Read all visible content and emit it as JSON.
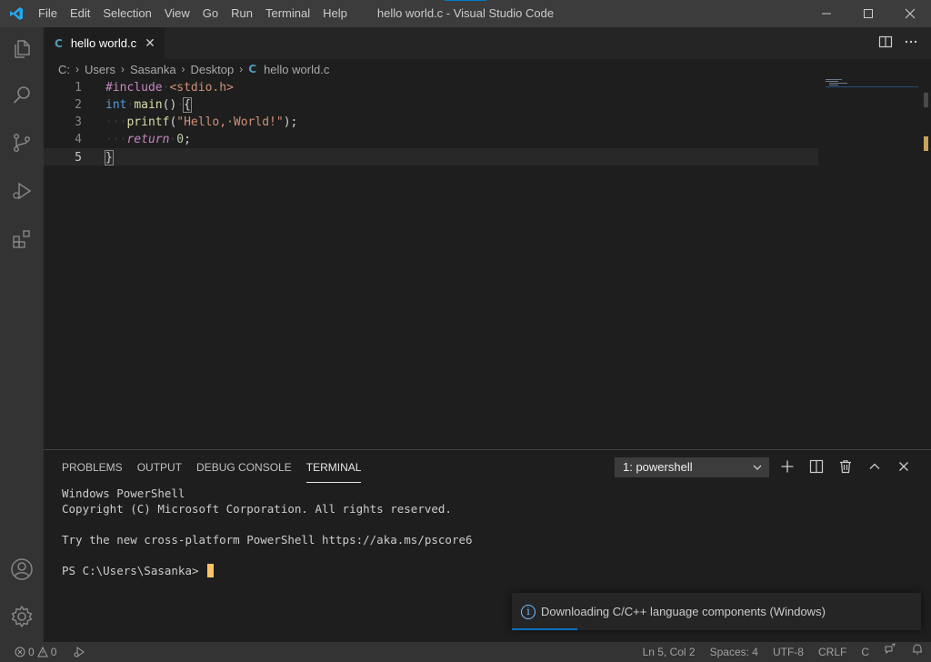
{
  "window": {
    "title": "hello world.c - Visual Studio Code",
    "menu": [
      "File",
      "Edit",
      "Selection",
      "View",
      "Go",
      "Run",
      "Terminal",
      "Help"
    ]
  },
  "activity_bar": {
    "items": [
      "explorer-icon",
      "search-icon",
      "source-control-icon",
      "run-debug-icon",
      "extensions-icon"
    ],
    "bottom": [
      "account-icon",
      "manage-gear-icon"
    ]
  },
  "tab": {
    "icon_text": "C",
    "label": "hello world.c",
    "close": "✕"
  },
  "breadcrumb": {
    "parts": [
      "C:",
      "Users",
      "Sasanka",
      "Desktop"
    ],
    "file_icon": "C",
    "file": "hello world.c"
  },
  "editor": {
    "line_numbers": [
      "1",
      "2",
      "3",
      "4",
      "5"
    ],
    "lines": [
      {
        "pre": "#include",
        "sp": "·",
        "inc": "<stdio.h>"
      },
      {
        "type": "int",
        "sp1": "·",
        "fn": "main",
        "rest": "()",
        "sp2": "·",
        "brace": "{"
      },
      {
        "ws": "···",
        "fn": "printf",
        "open": "(",
        "str": "\"Hello,·World!\"",
        "close": ");"
      },
      {
        "ws": "···",
        "kw": "return",
        "sp": "·",
        "num": "0",
        "semi": ";"
      },
      {
        "brace": "}"
      }
    ]
  },
  "panel": {
    "tabs": [
      "PROBLEMS",
      "OUTPUT",
      "DEBUG CONSOLE",
      "TERMINAL"
    ],
    "active_tab": "TERMINAL",
    "terminal_select": "1: powershell",
    "terminal_lines": [
      "Windows PowerShell",
      "Copyright (C) Microsoft Corporation. All rights reserved.",
      "",
      "Try the new cross-platform PowerShell https://aka.ms/pscore6",
      ""
    ],
    "prompt": "PS C:\\Users\\Sasanka>"
  },
  "notification": {
    "message": "Downloading C/C++ language components (Windows)",
    "icon": "info-icon"
  },
  "status_bar": {
    "errors": "0",
    "warnings": "0",
    "position": "Ln 5, Col 2",
    "spaces": "Spaces: 4",
    "encoding": "UTF-8",
    "eol": "CRLF",
    "language": "C"
  },
  "colors": {
    "accent": "#007acc",
    "cursor": "#ffc366",
    "c_icon": "#519aba"
  }
}
